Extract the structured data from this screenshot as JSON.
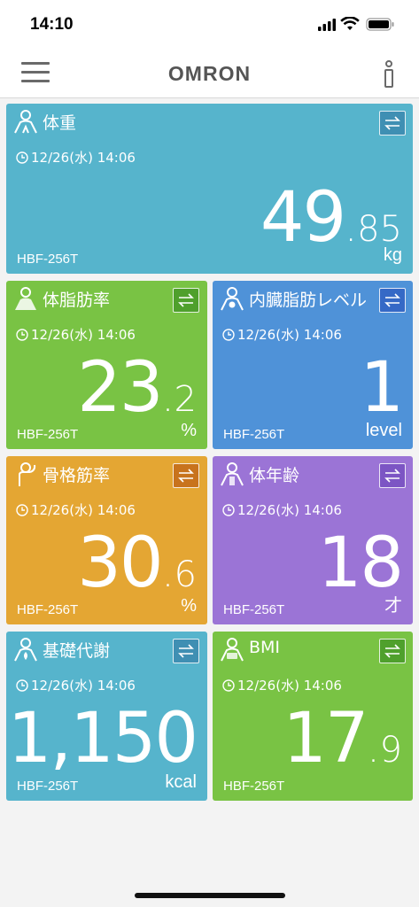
{
  "status": {
    "time": "14:10"
  },
  "header": {
    "logo": "OMRON"
  },
  "cards": [
    {
      "title": "体重",
      "date": "12/26(水) 14:06",
      "device": "HBF-256T",
      "int": "49",
      "dot": ".",
      "dec": "85",
      "unit": "kg",
      "color": "#56b4cc",
      "button_color": "#3f8fb3"
    },
    {
      "title": "体脂肪率",
      "date": "12/26(水) 14:06",
      "device": "HBF-256T",
      "int": "23",
      "dot": ".",
      "dec": "2",
      "unit": "%",
      "color": "#79c344",
      "button_color": "#4fa02c"
    },
    {
      "title": "内臓脂肪レベル",
      "date": "12/26(水) 14:06",
      "device": "HBF-256T",
      "int": "1",
      "dot": "",
      "dec": "",
      "unit": "level",
      "color": "#4f92d8",
      "button_color": "#3569c6"
    },
    {
      "title": "骨格筋率",
      "date": "12/26(水) 14:06",
      "device": "HBF-256T",
      "int": "30",
      "dot": ".",
      "dec": "6",
      "unit": "%",
      "color": "#e4a633",
      "button_color": "#c8731d"
    },
    {
      "title": "体年齢",
      "date": "12/26(水) 14:06",
      "device": "HBF-256T",
      "int": "18",
      "dot": "",
      "dec": "",
      "unit": "才",
      "color": "#9b74d6",
      "button_color": "#7c55c4"
    },
    {
      "title": "基礎代謝",
      "date": "12/26(水) 14:06",
      "device": "HBF-256T",
      "int": "1,150",
      "dot": "",
      "dec": "",
      "unit": "kcal",
      "color": "#56b4cc",
      "button_color": "#3f8fb3"
    },
    {
      "title": "BMI",
      "date": "12/26(水) 14:06",
      "device": "HBF-256T",
      "int": "17",
      "dot": ".",
      "dec": "9",
      "unit": "",
      "color": "#79c344",
      "button_color": "#4fa02c"
    }
  ]
}
